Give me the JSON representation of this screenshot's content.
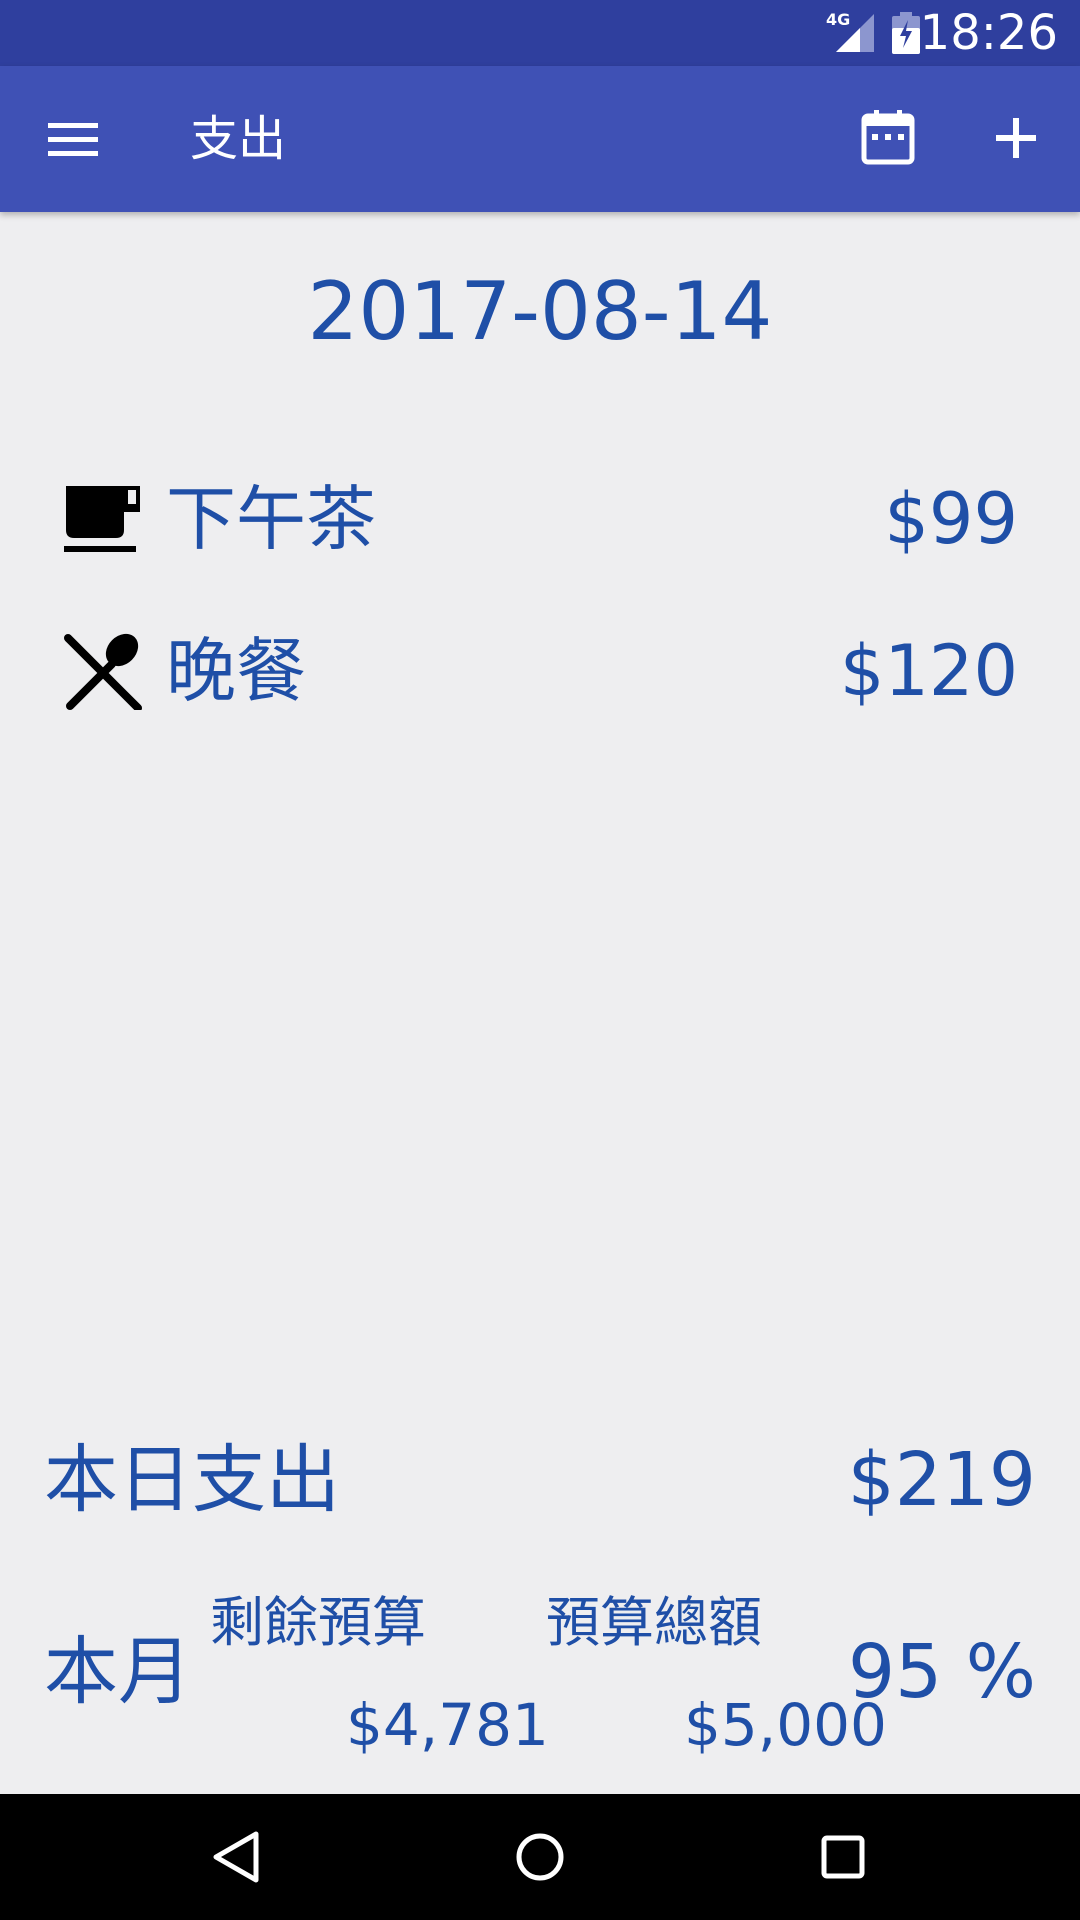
{
  "status_bar": {
    "network": "4G",
    "time": "18:26"
  },
  "app_bar": {
    "title": "支出",
    "menu_icon": "menu-icon",
    "calendar_icon": "calendar-icon",
    "add_icon": "add-icon"
  },
  "date": "2017-08-14",
  "entries": [
    {
      "icon": "coffee-cup-icon",
      "label": "下午茶",
      "amount": "$99"
    },
    {
      "icon": "utensils-icon",
      "label": "晚餐",
      "amount": "$120"
    }
  ],
  "summary": {
    "today_label": "本日支出",
    "today_amount": "$219",
    "month_label": "本月",
    "remaining_label": "剩餘預算",
    "remaining_value": "$4,781",
    "total_label": "預算總額",
    "total_value": "$5,000",
    "percent": "95 %"
  },
  "nav_bar": {
    "back_icon": "back-icon",
    "home_icon": "home-icon",
    "recents_icon": "recents-icon"
  },
  "colors": {
    "status_bar": "#2f3f9e",
    "app_bar": "#3f51b5",
    "text_accent": "#1f4fa7",
    "background": "#eeeef0"
  }
}
